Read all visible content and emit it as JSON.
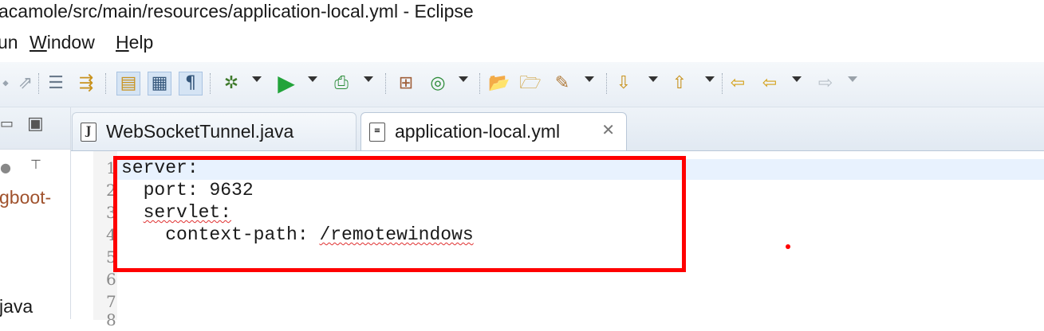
{
  "window": {
    "title": "acamole/src/main/resources/application-local.yml - Eclipse"
  },
  "menubar": {
    "items": [
      {
        "pre": "",
        "mnemonic": "",
        "post": "un"
      },
      {
        "pre": "",
        "mnemonic": "W",
        "post": "indow"
      },
      {
        "pre": "",
        "mnemonic": "H",
        "post": "elp"
      }
    ]
  },
  "toolbar": {
    "icons": [
      "prev-edit-icon",
      "step-icon",
      "step-return-icon",
      "toggle-mark-occurrences-icon",
      "toggle-block-select-icon",
      "show-whitespace-icon",
      "debug-icon",
      "run-icon",
      "run-external-tool-icon",
      "open-type-icon",
      "new-class-icon",
      "open-folder-icon",
      "open-project-icon",
      "search-icon",
      "next-annotation-icon",
      "previous-annotation-icon",
      "last-edit-location-icon",
      "back-icon",
      "forward-icon"
    ]
  },
  "left_panel": {
    "partial_text_1": "gboot-",
    "partial_text_2": "java",
    "icons": [
      "minimize-icon",
      "maximize-icon",
      "collapse-icon",
      "view-menu-icon"
    ]
  },
  "tabs": [
    {
      "label": "WebSocketTunnel.java",
      "icon": "java-file-icon",
      "active": false
    },
    {
      "label": "application-local.yml",
      "icon": "text-file-icon",
      "active": true,
      "close_glyph": "✕"
    }
  ],
  "editor": {
    "line_numbers": [
      "1",
      "2",
      "3",
      "4",
      "5",
      "6",
      "7",
      "8"
    ],
    "lines": [
      {
        "indent": "",
        "key": "server:",
        "value": ""
      },
      {
        "indent": "  ",
        "key": "port: ",
        "value": "9632"
      },
      {
        "indent": "  ",
        "key": "servlet:",
        "value": ""
      },
      {
        "indent": "    ",
        "key": "context-path: ",
        "value": "/remotewindows"
      }
    ]
  },
  "colors": {
    "highlight": "#ff0000",
    "current_line": "#e8f2fe",
    "tab_bg": "#e6edf5",
    "toolbar_bg": "#eef3f8",
    "package_text": "#a0522d"
  }
}
